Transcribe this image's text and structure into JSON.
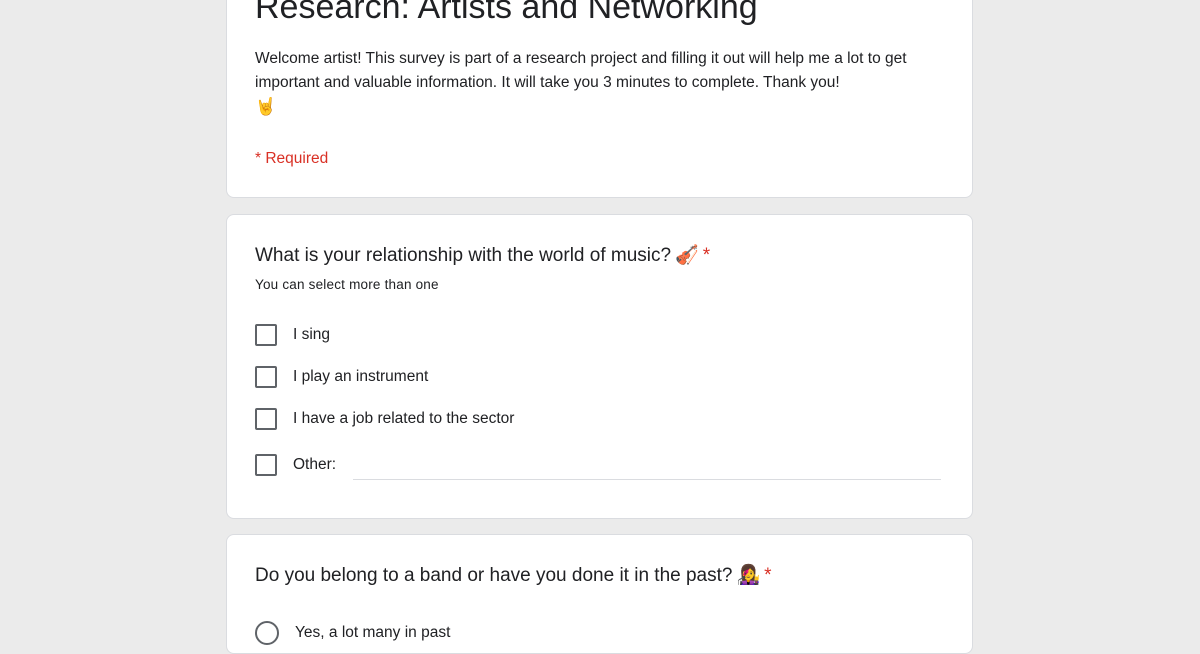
{
  "form": {
    "title": "Research: Artists and Networking",
    "description": "Welcome artist! This survey is part of a research project and filling it out will help me a lot to get important and valuable information. It will take you 3 minutes to complete. Thank you!",
    "description_emoji": "🤘",
    "required_note": "* Required"
  },
  "questions": [
    {
      "title": "What is your relationship with the world of music?",
      "emoji": "🎻",
      "required_marker": "*",
      "help_text": "You can select more than one",
      "options": [
        "I sing",
        "I play an instrument",
        "I have a job related to the sector",
        "Other:"
      ],
      "other_value": ""
    },
    {
      "title": "Do you belong to a band or have you done it in the past?",
      "emoji": "👩‍🎤",
      "required_marker": "*",
      "options": [
        "Yes, a lot many in past"
      ]
    }
  ],
  "icons": {
    "checkbox": "checkbox-icon",
    "radio": "radio-icon"
  },
  "colors": {
    "background": "#ebebeb",
    "required": "#d93025",
    "border": "#dadce0",
    "control": "#5f6368"
  }
}
